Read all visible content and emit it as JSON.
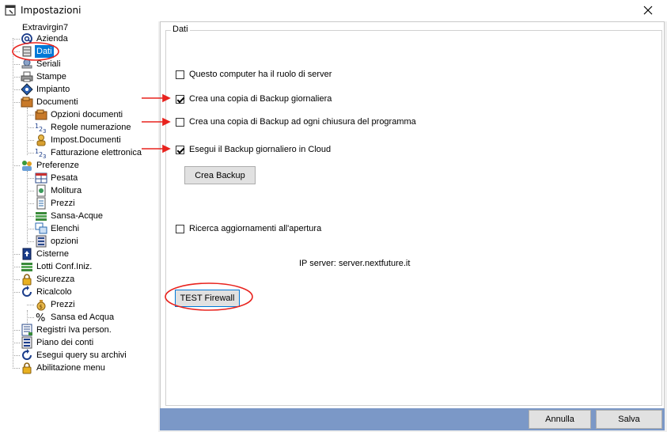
{
  "window": {
    "title": "Impostazioni"
  },
  "tree": {
    "root": "Extravirgin7",
    "items": [
      {
        "label": "Azienda",
        "icon": "at-icon"
      },
      {
        "label": "Dati",
        "icon": "database-icon",
        "selected": true
      },
      {
        "label": "Seriali",
        "icon": "key-icon"
      },
      {
        "label": "Stampe",
        "icon": "printer-icon"
      },
      {
        "label": "Impianto",
        "icon": "diamond-icon"
      },
      {
        "label": "Documenti",
        "icon": "folder-icon"
      },
      {
        "label": "Opzioni documenti",
        "icon": "folder-icon"
      },
      {
        "label": "Regole numerazione",
        "icon": "numbering-icon"
      },
      {
        "label": "Impost.Documenti",
        "icon": "user-icon"
      },
      {
        "label": "Fatturazione elettronica",
        "icon": "numbering-icon"
      },
      {
        "label": "Preferenze",
        "icon": "people-icon"
      },
      {
        "label": "Pesata",
        "icon": "grid-icon"
      },
      {
        "label": "Molitura",
        "icon": "document-icon"
      },
      {
        "label": "Prezzi",
        "icon": "list-icon"
      },
      {
        "label": "Sansa-Acque",
        "icon": "stack-icon"
      },
      {
        "label": "Elenchi",
        "icon": "windows-icon"
      },
      {
        "label": "opzioni",
        "icon": "options-icon"
      },
      {
        "label": "Cisterne",
        "icon": "tank-icon"
      },
      {
        "label": "Lotti Conf.Iniz.",
        "icon": "stack-icon"
      },
      {
        "label": "Sicurezza",
        "icon": "lock-icon"
      },
      {
        "label": "Ricalcolo",
        "icon": "refresh-icon"
      },
      {
        "label": "Prezzi",
        "icon": "moneybag-icon"
      },
      {
        "label": "Sansa ed Acqua",
        "icon": "percent-icon"
      },
      {
        "label": "Registri Iva person.",
        "icon": "register-icon"
      },
      {
        "label": "Piano dei conti",
        "icon": "accounts-icon"
      },
      {
        "label": "Esegui query su archivi",
        "icon": "refresh-icon"
      },
      {
        "label": "Abilitazione menu",
        "icon": "lock-icon"
      }
    ]
  },
  "panel": {
    "group_title": "Dati",
    "options": [
      {
        "label": "Questo computer ha il ruolo di server",
        "checked": false
      },
      {
        "label": "Crea una copia di Backup giornaliera",
        "checked": true
      },
      {
        "label": "Crea una copia di Backup ad ogni chiusura del programma",
        "checked": false
      },
      {
        "label": "Esegui il Backup giornaliero in Cloud",
        "checked": true
      }
    ],
    "backup_button": "Crea Backup",
    "updates_option": {
      "label": "Ricerca aggiornamenti all'apertura",
      "checked": false
    },
    "ip_label": "IP server:",
    "ip_value": "server.nextfuture.it",
    "firewall_button": "TEST Firewall"
  },
  "footer": {
    "cancel": "Annulla",
    "save": "Salva"
  },
  "colors": {
    "selection": "#0078d7",
    "footer_bar": "#7b98c7",
    "annotation": "#e8231e"
  }
}
